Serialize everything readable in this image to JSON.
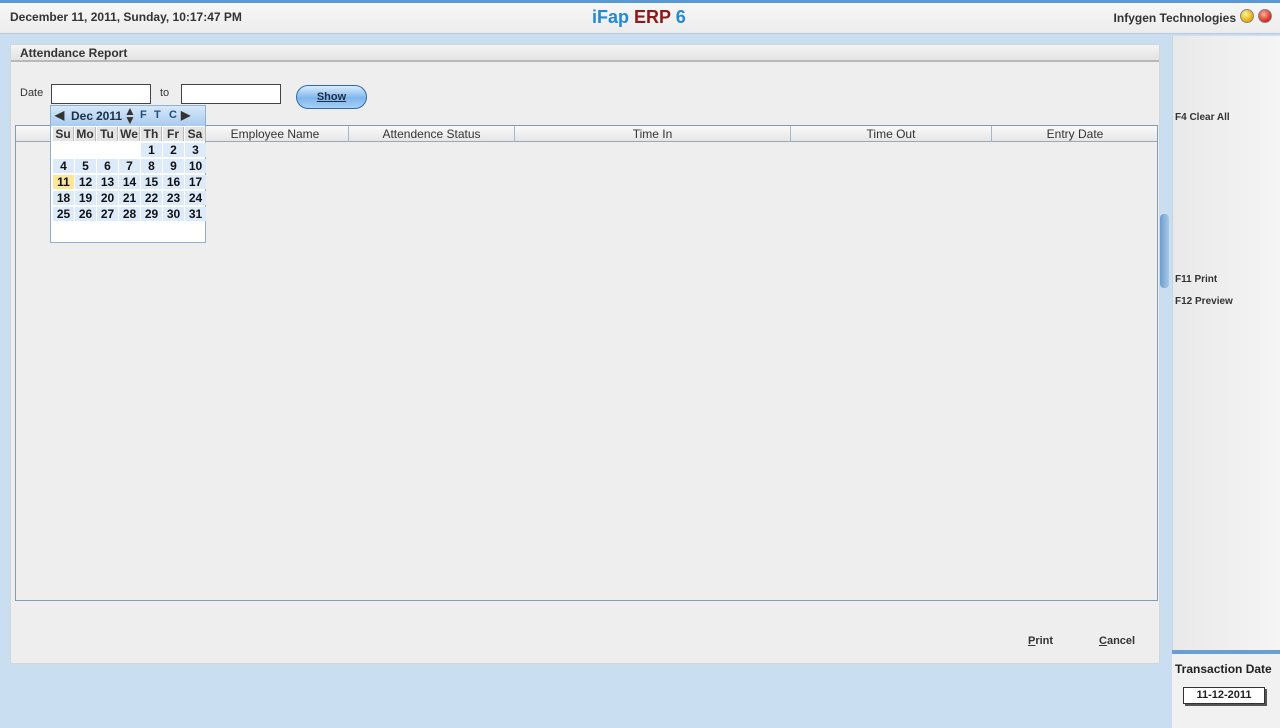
{
  "header": {
    "datetime": "December  11, 2011, Sunday, 10:17:47 PM",
    "brand_part1": "iFap ",
    "brand_part2": "ERP",
    "brand_part3": " 6",
    "company": "Infygen Technologies"
  },
  "panel": {
    "title": "Attendance Report"
  },
  "filter": {
    "date_label": "Date",
    "to_label": "to",
    "date_from_value": "",
    "date_to_value": "",
    "show_button": "Show"
  },
  "table": {
    "columns": [
      "Employee Name",
      "Attendence Status",
      "Time In",
      "Time Out",
      "Entry Date"
    ],
    "rows": []
  },
  "calendar": {
    "month": "Dec",
    "year": "2011",
    "options": [
      "F",
      "T",
      "C"
    ],
    "day_headers": [
      "Su",
      "Mo",
      "Tu",
      "We",
      "Th",
      "Fr",
      "Sa"
    ],
    "weeks": [
      [
        "",
        "",
        "",
        "",
        "1",
        "2",
        "3"
      ],
      [
        "4",
        "5",
        "6",
        "7",
        "8",
        "9",
        "10"
      ],
      [
        "11",
        "12",
        "13",
        "14",
        "15",
        "16",
        "17"
      ],
      [
        "18",
        "19",
        "20",
        "21",
        "22",
        "23",
        "24"
      ],
      [
        "25",
        "26",
        "27",
        "28",
        "29",
        "30",
        "31"
      ]
    ],
    "selected_day": "11"
  },
  "shortcuts": {
    "clear_all": "F4 Clear All",
    "print": "F11 Print",
    "preview": "F12 Preview"
  },
  "footer": {
    "print_accel": "P",
    "print_rest": "rint",
    "cancel_accel": "C",
    "cancel_rest": "ancel"
  },
  "transaction": {
    "label": "Transaction Date",
    "value": "11-12-2011"
  },
  "colors": {
    "accent": "#5b9bd5",
    "background": "#c9dff1",
    "today_highlight": "#fbe69a",
    "brand_blue": "#1f8ad8",
    "brand_red": "#8b1a1a"
  }
}
